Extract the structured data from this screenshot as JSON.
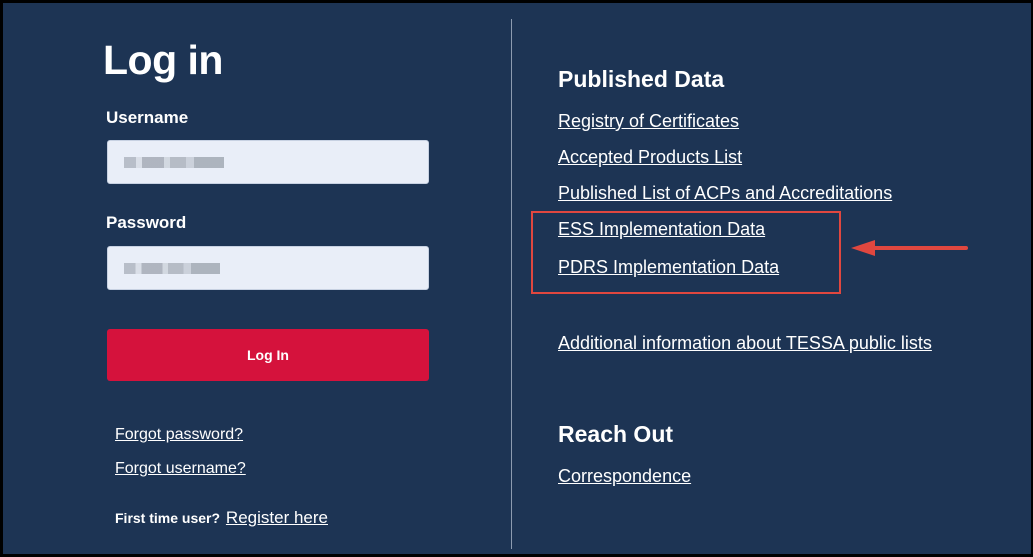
{
  "login": {
    "title": "Log in",
    "username_label": "Username",
    "password_label": "Password",
    "button_label": "Log In",
    "forgot_password": "Forgot password?",
    "forgot_username": "Forgot username?",
    "first_time_text": "First time user?",
    "register_link": "Register here"
  },
  "published_data": {
    "heading": "Published Data",
    "links": [
      "Registry of Certificates",
      "Accepted Products List",
      "Published List of ACPs and Accreditations",
      "ESS Implementation Data",
      "PDRS Implementation Data"
    ],
    "additional_info": "Additional information about TESSA public lists"
  },
  "reach_out": {
    "heading": "Reach Out",
    "correspondence": "Correspondence"
  },
  "colors": {
    "background": "#1d3454",
    "button": "#d5123c",
    "annotation": "#e0473f"
  },
  "icons": {
    "annotation_arrow": "arrow-left-icon"
  }
}
